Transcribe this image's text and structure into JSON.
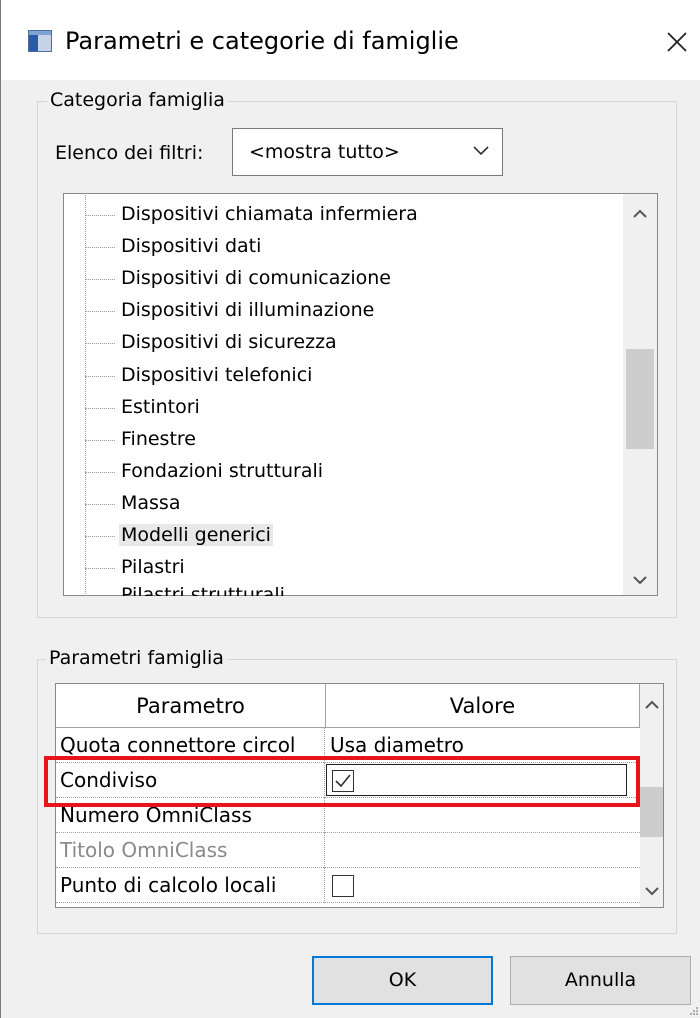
{
  "window": {
    "title": "Parametri e categorie di famiglie",
    "close_icon": "close-icon",
    "app_icon": "dialog-icon"
  },
  "category_group": {
    "legend": "Categoria famiglia",
    "filter_label": "Elenco dei filtri:",
    "filter_value": "<mostra tutto>",
    "tree_items": [
      {
        "label": "Dispositivi chiamata infermiera",
        "selected": false
      },
      {
        "label": "Dispositivi dati",
        "selected": false
      },
      {
        "label": "Dispositivi di comunicazione",
        "selected": false
      },
      {
        "label": "Dispositivi di illuminazione",
        "selected": false
      },
      {
        "label": "Dispositivi di sicurezza",
        "selected": false
      },
      {
        "label": "Dispositivi telefonici",
        "selected": false
      },
      {
        "label": "Estintori",
        "selected": false
      },
      {
        "label": "Finestre",
        "selected": false
      },
      {
        "label": "Fondazioni strutturali",
        "selected": false
      },
      {
        "label": "Massa",
        "selected": false
      },
      {
        "label": "Modelli generici",
        "selected": true
      },
      {
        "label": "Pilastri",
        "selected": false
      },
      {
        "label": "Pilastri strutturali",
        "selected": false
      }
    ]
  },
  "params_group": {
    "legend": "Parametri famiglia",
    "columns": [
      "Parametro",
      "Valore"
    ],
    "rows": [
      {
        "name": "Quota connettore circol",
        "value": "Usa diametro",
        "type": "text",
        "disabled": false
      },
      {
        "name": "Condiviso",
        "value": "",
        "type": "checkbox",
        "checked": true,
        "disabled": false
      },
      {
        "name": "Numero OmniClass",
        "value": "",
        "type": "text",
        "disabled": false
      },
      {
        "name": "Titolo OmniClass",
        "value": "",
        "type": "text",
        "disabled": true
      },
      {
        "name": "Punto di calcolo locali",
        "value": "",
        "type": "checkbox",
        "checked": false,
        "disabled": false
      }
    ]
  },
  "buttons": {
    "ok": "OK",
    "cancel": "Annulla"
  },
  "colors": {
    "highlight": "#e8141b",
    "dialog_bg": "#f0f0f0",
    "default_button_border": "#0078d7",
    "selected_item_bg": "#e8e8e8"
  }
}
